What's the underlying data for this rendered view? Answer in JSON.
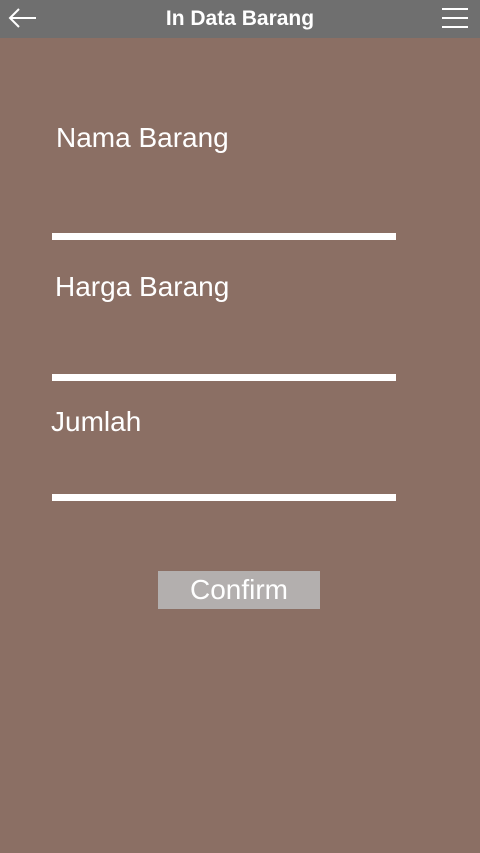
{
  "app_bar": {
    "title": "In Data Barang"
  },
  "form": {
    "nama_label": "Nama Barang",
    "nama_value": "",
    "harga_label": "Harga Barang",
    "harga_value": "",
    "jumlah_label": "Jumlah",
    "jumlah_value": "",
    "confirm_label": "Confirm"
  },
  "colors": {
    "background": "#8b6f64",
    "app_bar": "#6f6f6f",
    "button": "#b3afae",
    "text": "#ffffff"
  },
  "icons": {
    "back": "arrow-left-icon",
    "menu": "hamburger-menu-icon"
  }
}
